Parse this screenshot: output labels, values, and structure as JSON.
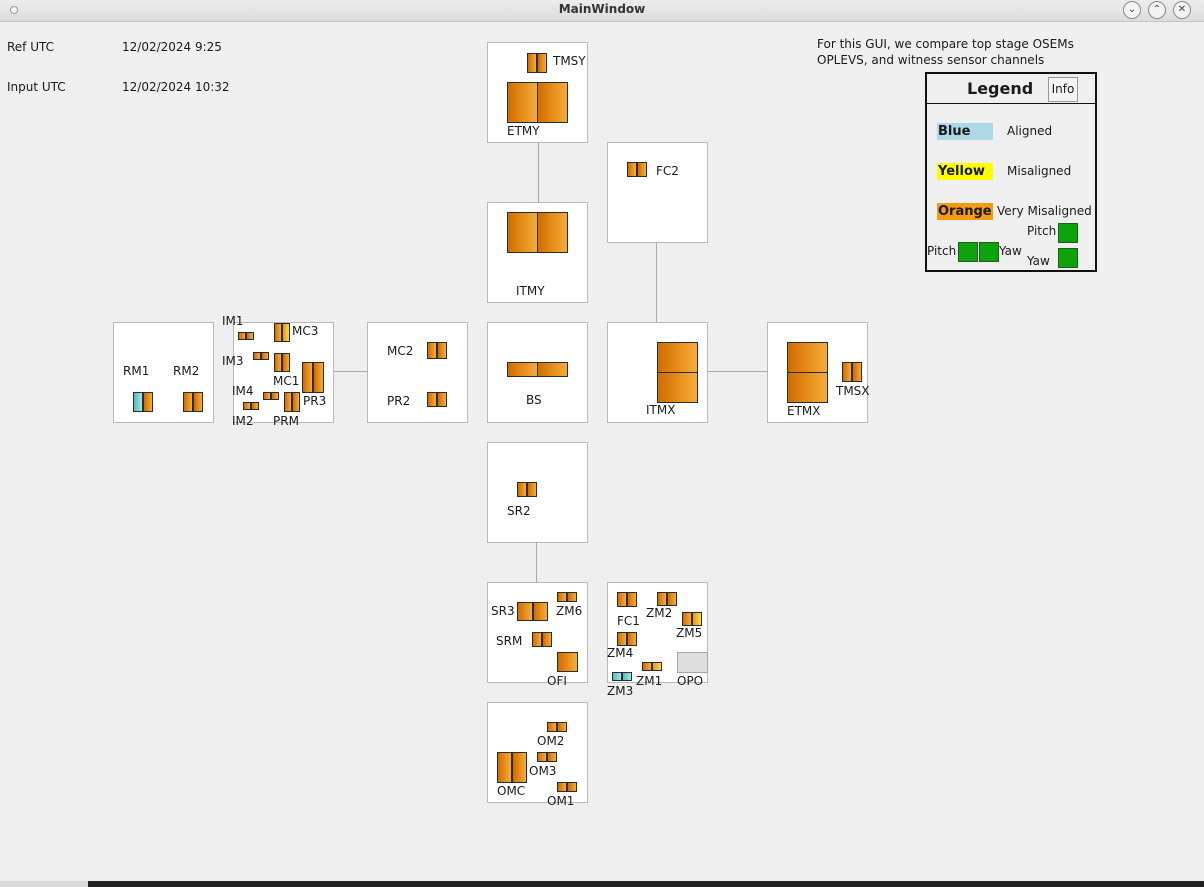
{
  "window": {
    "title": "MainWindow"
  },
  "ref_utc": {
    "label": "Ref UTC",
    "value": "12/02/2024 9:25"
  },
  "input_utc": {
    "label": "Input UTC",
    "value": "12/02/2024 10:32"
  },
  "description": {
    "line1": "For this GUI, we compare top stage OSEMs",
    "line2": "OPLEVS, and witness sensor channels"
  },
  "legend": {
    "title": "Legend",
    "info_button": "Info",
    "items": [
      {
        "key": "Blue",
        "text": "Aligned",
        "color": "#add8e6"
      },
      {
        "key": "Yellow",
        "text": "Misaligned",
        "color": "#ffff00"
      },
      {
        "key": "Orange",
        "text": "Very Misaligned",
        "color": "#f39c12"
      }
    ],
    "pitch_label": "Pitch",
    "yaw_label": "Yaw",
    "pitch_label2": "Pitch",
    "yaw_label2": "Yaw",
    "indicator_color": "#0aa40a"
  },
  "optics": {
    "tmsy": "TMSY",
    "etmy": "ETMY",
    "fc2": "FC2",
    "itmy": "ITMY",
    "rm1": "RM1",
    "rm2": "RM2",
    "im1": "IM1",
    "im2": "IM2",
    "im3": "IM3",
    "im4": "IM4",
    "mc1": "MC1",
    "mc2": "MC2",
    "mc3": "MC3",
    "pr2": "PR2",
    "pr3": "PR3",
    "prm": "PRM",
    "bs": "BS",
    "itmx": "ITMX",
    "etmx": "ETMX",
    "tmsx": "TMSX",
    "sr2": "SR2",
    "sr3": "SR3",
    "srm": "SRM",
    "zm6": "ZM6",
    "ofi": "OFI",
    "fc1": "FC1",
    "zm1": "ZM1",
    "zm2": "ZM2",
    "zm3": "ZM3",
    "zm4": "ZM4",
    "zm5": "ZM5",
    "opo": "OPO",
    "om1": "OM1",
    "om2": "OM2",
    "om3": "OM3",
    "omc": "OMC"
  },
  "status_colors": {
    "very_misaligned": "#e0820f",
    "misaligned": "#f7d94c",
    "aligned": "#7fd0d6"
  }
}
